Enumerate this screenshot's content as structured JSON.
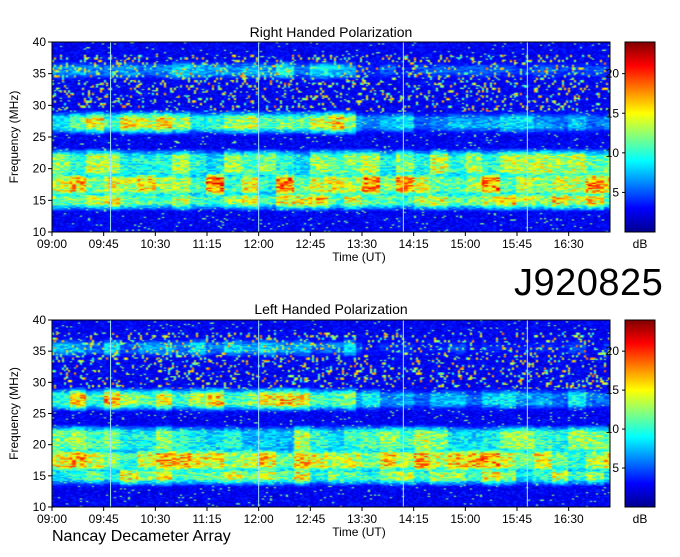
{
  "observation_id": "J920825",
  "instrument": "Nancay Decameter Array",
  "colors": {
    "colormap": [
      "#00008f",
      "#0000ff",
      "#0080ff",
      "#00ffff",
      "#80ff80",
      "#ffff00",
      "#ff8000",
      "#ff0000",
      "#800000"
    ],
    "guide_line": "#9fe8ff"
  },
  "chart_data": [
    {
      "type": "heatmap",
      "title": "Right Handed Polarization",
      "xlabel": "Time (UT)",
      "ylabel": "Frequency (MHz)",
      "x_ticks": [
        "09:00",
        "09:45",
        "10:30",
        "11:15",
        "12:00",
        "12:45",
        "13:30",
        "14:15",
        "15:00",
        "15:45",
        "16:30"
      ],
      "x_range_hours": [
        9.0,
        17.1
      ],
      "y_ticks": [
        10,
        15,
        20,
        25,
        30,
        35,
        40
      ],
      "ylim": [
        10,
        40
      ],
      "colorbar": {
        "label": "dB",
        "ticks": [
          5,
          10,
          15,
          20
        ],
        "range": [
          0,
          24
        ]
      },
      "intense_bands_mhz": [
        {
          "low": 14.5,
          "high": 15.5,
          "level": 20
        },
        {
          "low": 16.5,
          "high": 18.5,
          "level": 22
        },
        {
          "low": 19.5,
          "high": 22.0,
          "level": 18
        },
        {
          "low": 26.5,
          "high": 28.0,
          "level": 20
        },
        {
          "low": 35.0,
          "high": 36.0,
          "level": 12
        }
      ],
      "vertical_guides_ut": [
        "09:51",
        "12:00",
        "14:06",
        "15:54"
      ]
    },
    {
      "type": "heatmap",
      "title": "Left Handed Polarization",
      "xlabel": "Time (UT)",
      "ylabel": "Frequency (MHz)",
      "x_ticks": [
        "09:00",
        "09:45",
        "10:30",
        "11:15",
        "12:00",
        "12:45",
        "13:30",
        "14:15",
        "15:00",
        "15:45",
        "16:30"
      ],
      "x_range_hours": [
        9.0,
        17.1
      ],
      "y_ticks": [
        10,
        15,
        20,
        25,
        30,
        35,
        40
      ],
      "ylim": [
        10,
        40
      ],
      "colorbar": {
        "label": "dB",
        "ticks": [
          5,
          10,
          15,
          20
        ],
        "range": [
          0,
          24
        ]
      },
      "intense_bands_mhz": [
        {
          "low": 14.5,
          "high": 15.5,
          "level": 19
        },
        {
          "low": 16.5,
          "high": 18.5,
          "level": 21
        },
        {
          "low": 19.5,
          "high": 22.0,
          "level": 17
        },
        {
          "low": 26.5,
          "high": 28.0,
          "level": 21
        },
        {
          "low": 35.0,
          "high": 36.0,
          "level": 11
        }
      ],
      "vertical_guides_ut": [
        "09:51",
        "12:00",
        "14:06",
        "15:54"
      ]
    }
  ]
}
